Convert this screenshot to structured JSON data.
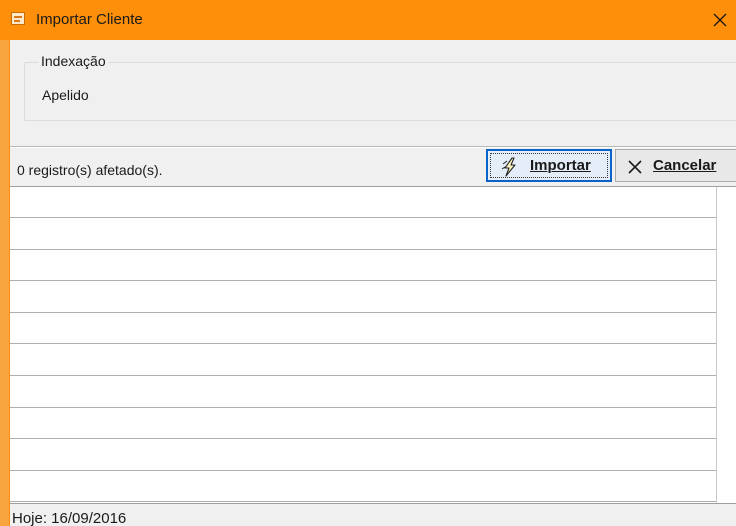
{
  "window": {
    "title": "Importar Cliente",
    "icon": "app-icon",
    "close_icon": "close-icon"
  },
  "indexacao": {
    "legend": "Indexação",
    "value": "Apelido"
  },
  "toolbar": {
    "status": "0 registro(s) afetado(s).",
    "import_button": {
      "label": "Importar",
      "icon": "lightning-icon"
    },
    "cancel_button": {
      "label": "Cancelar",
      "icon": "x-icon"
    }
  },
  "grid": {
    "rows": [
      "",
      "",
      "",
      "",
      "",
      "",
      "",
      "",
      "",
      ""
    ]
  },
  "statusbar": {
    "date": "Hoje: 16/09/2016"
  },
  "colors": {
    "titlebar": "#fd8f0a",
    "focus": "#0a64c8"
  }
}
